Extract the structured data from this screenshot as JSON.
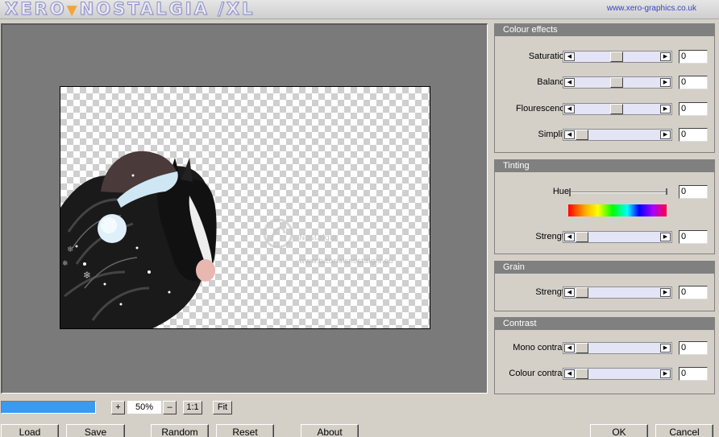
{
  "header": {
    "logo_left": "XERO",
    "logo_right": "NOSTALGIA /XL",
    "url": "www.xero-graphics.co.uk"
  },
  "preview": {
    "watermark_text": "www.tutorialsnostalgia.eu"
  },
  "zoom": {
    "plus_label": "+",
    "value": "50%",
    "minus_label": "–",
    "one_to_one_label": "1:1",
    "fit_label": "Fit",
    "progress_fraction": 1.0
  },
  "buttons": {
    "load": "Load",
    "save": "Save",
    "random": "Random",
    "reset": "Reset",
    "about": "About",
    "ok": "OK",
    "cancel": "Cancel"
  },
  "panels": {
    "colour_effects": {
      "title": "Colour effects",
      "saturation": {
        "label": "Saturation",
        "value": "0",
        "position": 0.5
      },
      "balance": {
        "label": "Balance",
        "value": "0",
        "position": 0.5
      },
      "flourescence": {
        "label": "Flourescence",
        "value": "0",
        "position": 0.5
      },
      "simplify": {
        "label": "Simplify",
        "value": "0",
        "position": 0.0
      }
    },
    "tinting": {
      "title": "Tinting",
      "hue": {
        "label": "Hue",
        "value": "0",
        "position": 0.0
      },
      "strength": {
        "label": "Strength",
        "value": "0",
        "position": 0.0
      }
    },
    "grain": {
      "title": "Grain",
      "strength": {
        "label": "Strength",
        "value": "0",
        "position": 0.0
      }
    },
    "contrast": {
      "title": "Contrast",
      "mono_contrast": {
        "label": "Mono contrast",
        "value": "0",
        "position": 0.0
      },
      "colour_contrast": {
        "label": "Colour contrast",
        "value": "0",
        "position": 0.0
      }
    }
  },
  "colors": {
    "panel_title_bg": "#808080",
    "progress": "#3a9af0",
    "url_color": "#3a44c4",
    "logo_accent": "#f2a43a"
  },
  "icons": {
    "arrow_left": "arrow-left-icon",
    "arrow_right": "arrow-right-icon"
  }
}
